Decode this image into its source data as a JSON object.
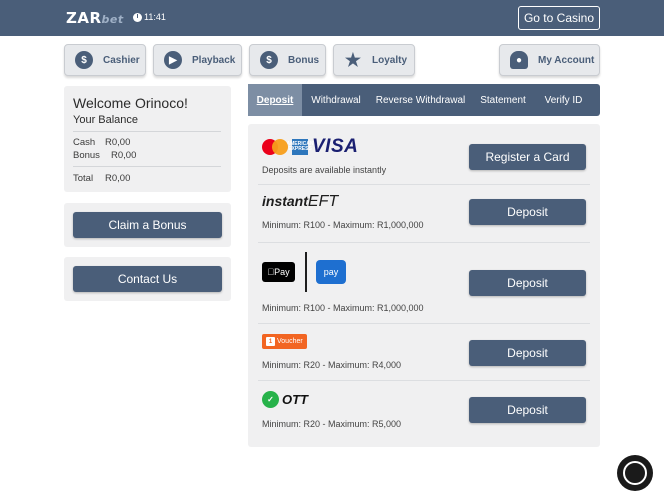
{
  "header": {
    "logo_main": "ZAR",
    "logo_sub": "bet",
    "time": "11:41",
    "casino_button": "Go to Casino"
  },
  "nav": [
    {
      "label": "Cashier",
      "icon": "coins-icon"
    },
    {
      "label": "Playback",
      "icon": "playback-icon"
    },
    {
      "label": "Bonus",
      "icon": "bonus-icon"
    },
    {
      "label": "Loyalty",
      "icon": "star-icon"
    },
    {
      "label": "My Account",
      "icon": "user-icon"
    }
  ],
  "welcome": {
    "title": "Welcome Orinoco!",
    "subtitle": "Your Balance",
    "cash_label": "Cash",
    "cash_value": "R0,00",
    "bonus_label": "Bonus",
    "bonus_value": "R0,00",
    "total_label": "Total",
    "total_value": "R0,00"
  },
  "claim_button": "Claim a Bonus",
  "contact_button": "Contact Us",
  "tabs": [
    {
      "label": "Deposit",
      "active": true
    },
    {
      "label": "Withdrawal",
      "active": false
    },
    {
      "label": "Reverse Withdrawal",
      "active": false
    },
    {
      "label": "Statement",
      "active": false
    },
    {
      "label": "Verify ID",
      "active": false
    }
  ],
  "methods": {
    "cards": {
      "brand_amex": "AMERICAN EXPRESS",
      "brand_visa": "VISA",
      "desc": "Deposits are available instantly",
      "button": "Register a Card"
    },
    "eft": {
      "logo_a": "instant",
      "logo_b": "EFT",
      "desc": "Minimum: R100 - Maximum: R1,000,000",
      "button": "Deposit"
    },
    "wallet": {
      "apple_label": "Pay",
      "samsung_label": "pay",
      "desc": "Minimum: R100 - Maximum: R1,000,000",
      "button": "Deposit"
    },
    "voucher": {
      "badge": "1",
      "label": "Voucher",
      "desc": "Minimum: R20 - Maximum: R4,000",
      "button": "Deposit"
    },
    "ott": {
      "label": "OTT",
      "desc": "Minimum: R20 - Maximum: R5,000",
      "button": "Deposit"
    }
  },
  "colors": {
    "primary": "#4a5e79",
    "panel": "#f0f0f1",
    "active_tab": "#7d8ea4"
  }
}
